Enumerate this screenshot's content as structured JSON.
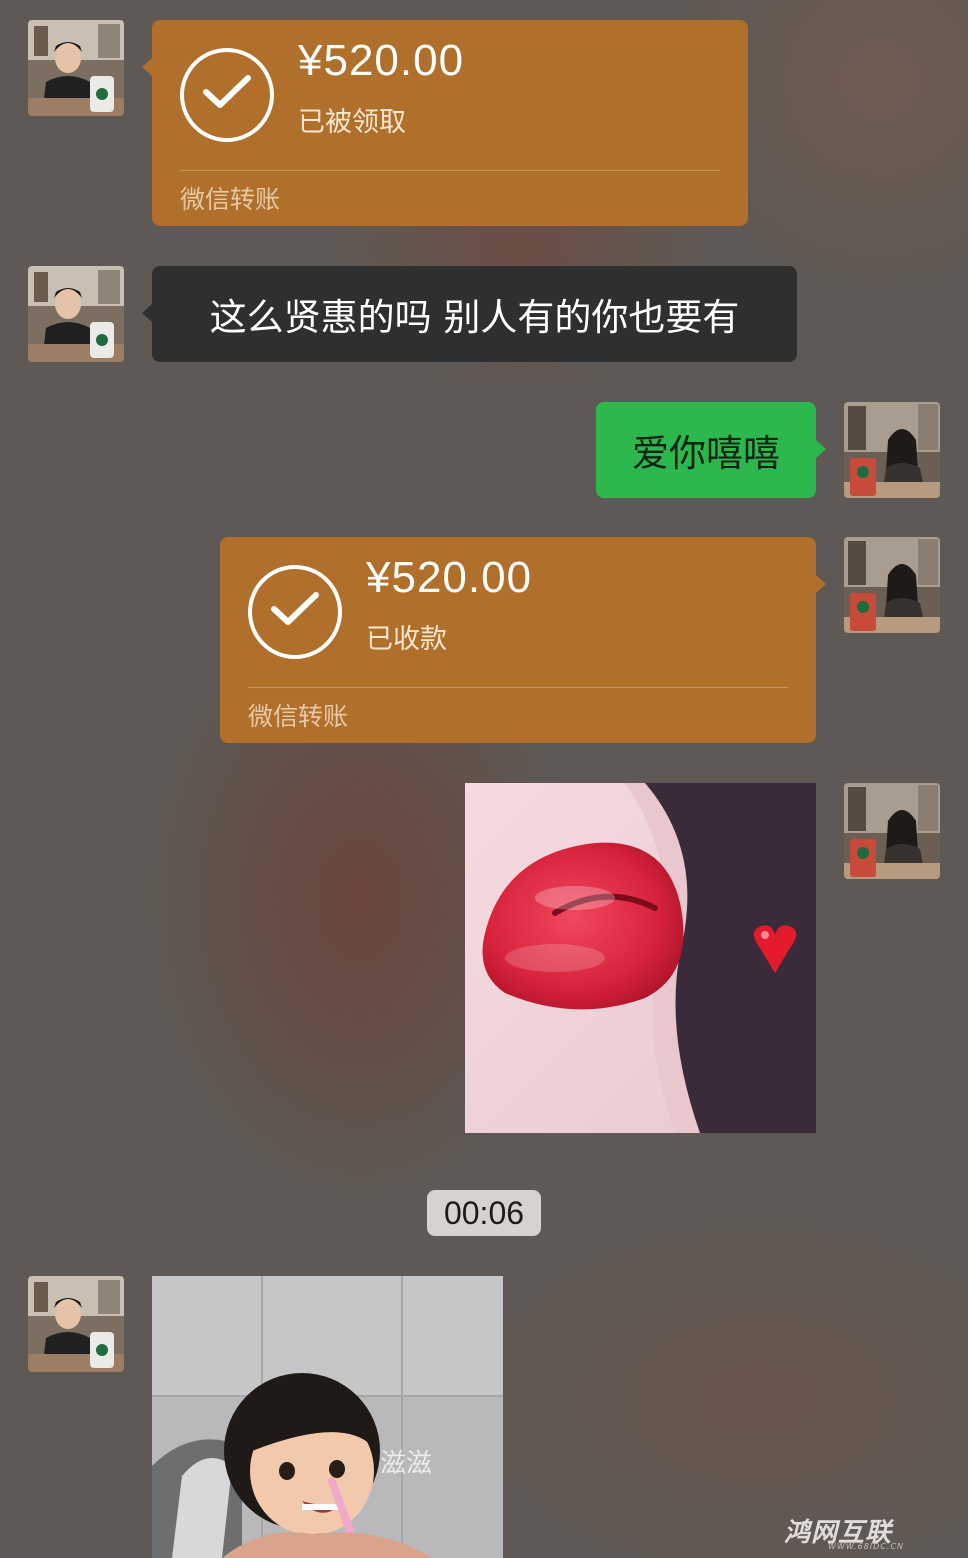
{
  "messages": [
    {
      "sender": "contact",
      "type": "transfer",
      "amount": "¥520.00",
      "status": "已被领取",
      "label": "微信转账"
    },
    {
      "sender": "contact",
      "type": "text",
      "text": "这么贤惠的吗  别人有的你也要有"
    },
    {
      "sender": "me",
      "type": "text",
      "text": "爱你嘻嘻"
    },
    {
      "sender": "me",
      "type": "transfer",
      "amount": "¥520.00",
      "status": "已收款",
      "label": "微信转账"
    },
    {
      "sender": "me",
      "type": "image",
      "icon": "lips-photo"
    },
    {
      "type": "timestamp",
      "text": "00:06"
    },
    {
      "sender": "contact",
      "type": "image",
      "icon": "baby-toothbrush-photo",
      "caption": "滋滋"
    }
  ],
  "colors": {
    "transfer_bubble": "#b06f2a",
    "sent_bubble": "#2cb84f",
    "received_dark_bubble": "#2f2f2f",
    "background": "#5f5955"
  },
  "watermark": {
    "main": "鸿网互联",
    "sub": "WWW.68IDC.CN"
  }
}
